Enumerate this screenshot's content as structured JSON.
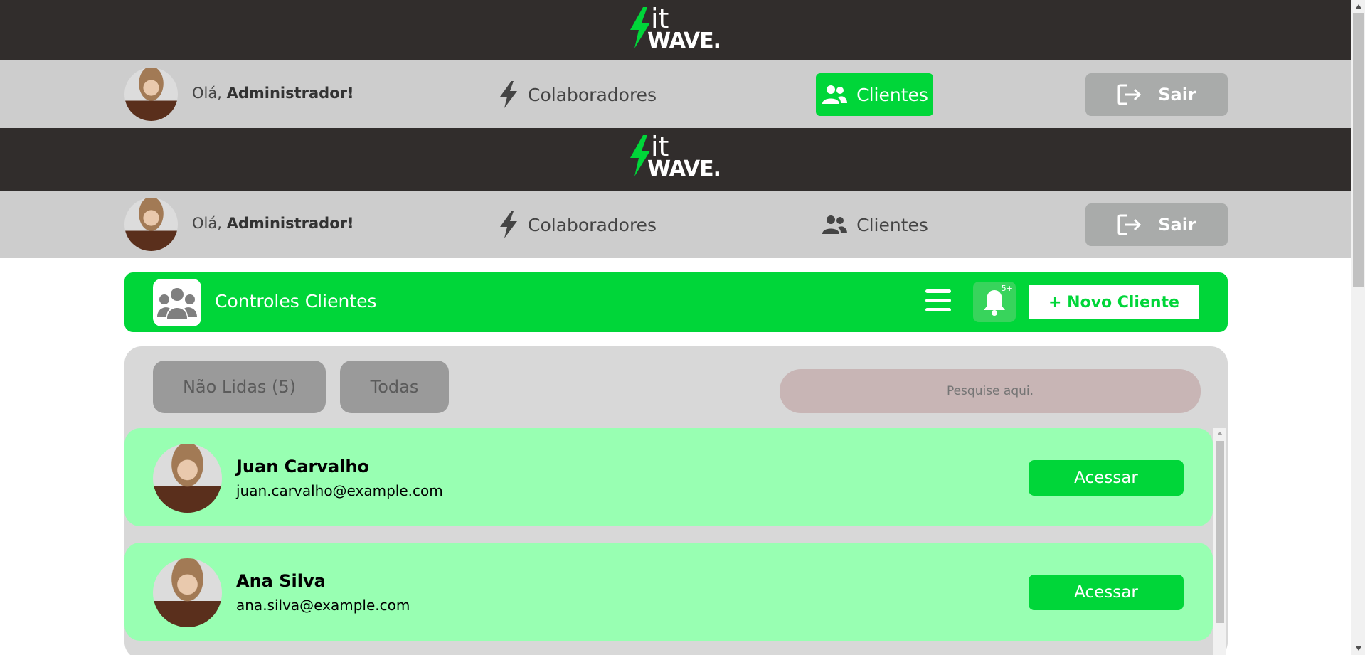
{
  "brand": {
    "it": "it",
    "wave": "WAVE.",
    "accent": "#00d639"
  },
  "nav": {
    "greeting_prefix": "Olá, ",
    "greeting_name": "Administrador!",
    "colaboradores": "Colaboradores",
    "clientes": "Clientes",
    "sair": "Sair"
  },
  "controls": {
    "title": "Controles Clientes",
    "badge": "5+",
    "new_client": "+ Novo Cliente"
  },
  "filters": {
    "unread": "Não Lidas (5)",
    "all": "Todas",
    "search_placeholder": "Pesquise aqui."
  },
  "clients": [
    {
      "name": "Juan Carvalho",
      "email": "juan.carvalho@example.com",
      "action": "Acessar"
    },
    {
      "name": "Ana Silva",
      "email": "ana.silva@example.com",
      "action": "Acessar"
    }
  ]
}
